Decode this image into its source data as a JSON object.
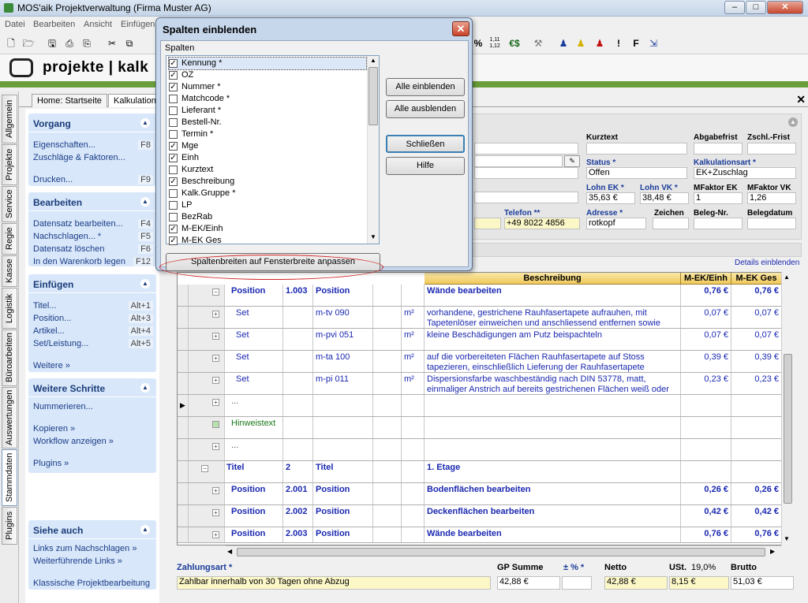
{
  "window": {
    "title": "MOS'aik Projektverwaltung (Firma Muster AG)",
    "min": "–",
    "max": "□",
    "close": "✕"
  },
  "menu": [
    "Datei",
    "Bearbeiten",
    "Ansicht",
    "Einfügen"
  ],
  "toolbar_right": [
    "%",
    "1,11 1,12",
    "€$",
    "⚒",
    "♟",
    "♟",
    "♟",
    "!",
    "F",
    "⇲"
  ],
  "brand": {
    "name": "projekte | kalk"
  },
  "vtabs": [
    "Allgemein",
    "Projekte",
    "Service",
    "Regie",
    "Kasse",
    "Logistik",
    "Büroarbeiten",
    "Auswertungen",
    "Stammdaten",
    "Plugins"
  ],
  "tabs": [
    "Home: Startseite",
    "Kalkulation"
  ],
  "sidebar": {
    "vorgang": {
      "title": "Vorgang",
      "items": [
        {
          "label": "Eigenschaften...",
          "key": "F8"
        },
        {
          "label": "Zuschläge & Faktoren...",
          "key": ""
        },
        {
          "label": "Drucken...",
          "key": "F9"
        }
      ]
    },
    "bearbeiten": {
      "title": "Bearbeiten",
      "items": [
        {
          "label": "Datensatz bearbeiten...",
          "key": "F4"
        },
        {
          "label": "Nachschlagen... *",
          "key": "F5"
        },
        {
          "label": "Datensatz löschen",
          "key": "F6"
        },
        {
          "label": "In den Warenkorb legen",
          "key": "F12"
        }
      ]
    },
    "einfuegen": {
      "title": "Einfügen",
      "items": [
        {
          "label": "Titel...",
          "key": "Alt+1"
        },
        {
          "label": "Position...",
          "key": "Alt+3"
        },
        {
          "label": "Artikel...",
          "key": "Alt+4"
        },
        {
          "label": "Set/Leistung...",
          "key": "Alt+5"
        },
        {
          "label": "Weitere »",
          "key": ""
        }
      ]
    },
    "weitere": {
      "title": "Weitere Schritte",
      "items": [
        {
          "label": "Nummerieren..."
        },
        {
          "label": "Kopieren »"
        },
        {
          "label": "Workflow anzeigen »"
        },
        {
          "label": "Plugins »"
        }
      ]
    },
    "siehe": {
      "title": "Siehe auch",
      "items": [
        {
          "label": "Links zum Nachschlagen »"
        },
        {
          "label": "Weiterführende Links »"
        },
        {
          "label": "Klassische Projektbearbeitung"
        }
      ]
    }
  },
  "form": {
    "kurztext_l": "Kurztext",
    "abgabefrist_l": "Abgabefrist",
    "zschl_l": "Zschl.-Frist",
    "status_l": "Status *",
    "status_v": "Offen",
    "kalkart_l": "Kalkulationsart *",
    "kalkart_v": "EK+Zuschlag",
    "lohnek_l": "Lohn EK *",
    "lohnek_v": "35,63 €",
    "lohnvk_l": "Lohn VK *",
    "lohnvk_v": "38,48 €",
    "mfek_l": "MFaktor EK",
    "mfek_v": "1",
    "mfvk_l": "MFaktor VK",
    "mfvk_v": "1,26",
    "telefon_l": "Telefon **",
    "telefon_v": "+49 8022 4856",
    "adresse_l": "Adresse *",
    "adresse_v": "rotkopf",
    "zeichen_l": "Zeichen",
    "belegnr_l": "Beleg-Nr.",
    "belegdatum_l": "Belegdatum"
  },
  "details_link": "Details einblenden",
  "grid": {
    "headers": {
      "beschreibung": "Beschreibung",
      "mek": "M-EK/Einh",
      "mekges": "M-EK Ges"
    },
    "rows": [
      {
        "type": "Position",
        "oz": "1.003",
        "kenn": "Position",
        "me": "",
        "beschr": "Wände bearbeiten",
        "mek": "0,76 €",
        "mekges": "0,76 €",
        "bold": true,
        "h": 28
      },
      {
        "type": "Set",
        "oz": "",
        "kenn": "m-tv 090",
        "me": "m²",
        "beschr": "vorhandene, gestrichene Rauhfasertapete aufrauhen, mit Tapetenlöser einweichen und anschliessend entfernen sowie",
        "mek": "0,07 €",
        "mekges": "0,07 €",
        "bold": false,
        "h": 28
      },
      {
        "type": "Set",
        "oz": "",
        "kenn": "m-pvi 051",
        "me": "m²",
        "beschr": "kleine Beschädigungen am Putz beispachteln",
        "mek": "0,07 €",
        "mekges": "0,07 €",
        "bold": false,
        "h": 28
      },
      {
        "type": "Set",
        "oz": "",
        "kenn": "m-ta 100",
        "me": "m²",
        "beschr": "auf die vorbereiteten Flächen Rauhfasertapete auf Stoss tapezieren, einschließlich Lieferung der Rauhfasertapete",
        "mek": "0,39 €",
        "mekges": "0,39 €",
        "bold": false,
        "h": 28
      },
      {
        "type": "Set",
        "oz": "",
        "kenn": "m-pi 011",
        "me": "m²",
        "beschr": "Dispersionsfarbe waschbeständig nach DIN 53778, matt, einmaliger Anstrich auf bereits gestrichenen Flächen weiß oder hell",
        "mek": "0,23 €",
        "mekges": "0,23 €",
        "bold": false,
        "h": 28
      },
      {
        "type": "...",
        "oz": "",
        "kenn": "",
        "me": "",
        "beschr": "",
        "mek": "",
        "mekges": "",
        "bold": false,
        "h": 28
      },
      {
        "type": "Hinweistext",
        "oz": "",
        "kenn": "",
        "me": "",
        "beschr": "",
        "mek": "",
        "mekges": "",
        "bold": false,
        "h": 28
      },
      {
        "type": "...",
        "oz": "",
        "kenn": "",
        "me": "",
        "beschr": "",
        "mek": "",
        "mekges": "",
        "bold": false,
        "h": 28
      },
      {
        "type": "Titel",
        "oz": "2",
        "kenn": "Titel",
        "me": "",
        "beschr": "1. Etage",
        "mek": "",
        "mekges": "",
        "bold": true,
        "h": 28
      },
      {
        "type": "Position",
        "oz": "2.001",
        "kenn": "Position",
        "me": "",
        "beschr": "Bodenflächen bearbeiten",
        "mek": "0,26 €",
        "mekges": "0,26 €",
        "bold": true,
        "h": 28
      },
      {
        "type": "Position",
        "oz": "2.002",
        "kenn": "Position",
        "me": "",
        "beschr": "Deckenflächen bearbeiten",
        "mek": "0,42 €",
        "mekges": "0,42 €",
        "bold": true,
        "h": 28
      },
      {
        "type": "Position",
        "oz": "2.003",
        "kenn": "Position",
        "me": "",
        "beschr": "Wände bearbeiten",
        "mek": "0,76 €",
        "mekges": "0,76 €",
        "bold": true,
        "h": 20
      }
    ]
  },
  "footer": {
    "zahlungsart_l": "Zahlungsart *",
    "zahlungsart_v": "Zahlbar innerhalb von 30 Tagen ohne Abzug",
    "gp_l": "GP Summe",
    "gp_v": "42,88 €",
    "pct_l": "± % *",
    "pct_v": "",
    "netto_l": "Netto",
    "netto_v": "42,88 €",
    "ust_l": "USt.",
    "ust_rate": "19,0%",
    "ust_v": "8,15 €",
    "brutto_l": "Brutto",
    "brutto_v": "51,03 €"
  },
  "dialog": {
    "title": "Spalten einblenden",
    "group": "Spalten",
    "columns": [
      {
        "label": "Kennung *",
        "checked": true
      },
      {
        "label": "OZ",
        "checked": true
      },
      {
        "label": "Nummer *",
        "checked": true
      },
      {
        "label": "Matchcode *",
        "checked": false
      },
      {
        "label": "Lieferant *",
        "checked": false
      },
      {
        "label": "Bestell-Nr.",
        "checked": false
      },
      {
        "label": "Termin *",
        "checked": false
      },
      {
        "label": "Mge",
        "checked": true
      },
      {
        "label": "Einh",
        "checked": true
      },
      {
        "label": "Kurztext",
        "checked": false
      },
      {
        "label": "Beschreibung",
        "checked": true
      },
      {
        "label": "Kalk.Gruppe *",
        "checked": false
      },
      {
        "label": "LP",
        "checked": false
      },
      {
        "label": "BezRab",
        "checked": false
      },
      {
        "label": "M-EK/Einh",
        "checked": true
      },
      {
        "label": "M-EK Ges",
        "checked": true
      }
    ],
    "btn_show_all": "Alle einblenden",
    "btn_hide_all": "Alle ausblenden",
    "btn_close": "Schließen",
    "btn_help": "Hilfe",
    "btn_fit": "Spaltenbreiten auf Fensterbreite anpassen"
  }
}
